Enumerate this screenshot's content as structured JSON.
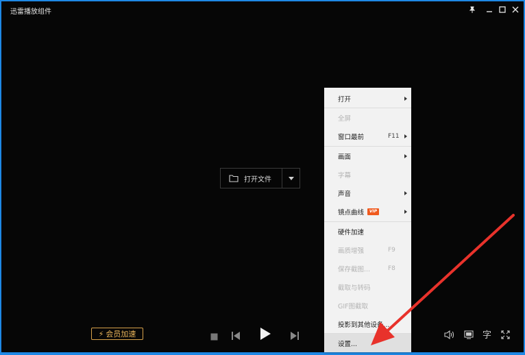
{
  "window": {
    "title": "迅雷播放组件"
  },
  "center": {
    "open_file_label": "打开文件"
  },
  "bottom": {
    "vip_label": "会员加速",
    "subtitle_label": "字"
  },
  "menu": {
    "items": [
      {
        "label": "打开",
        "shortcut": "",
        "submenu": true,
        "disabled": false
      },
      {
        "label": "全屏",
        "shortcut": "",
        "submenu": false,
        "disabled": true
      },
      {
        "label": "窗口最前",
        "shortcut": "F11",
        "submenu": true,
        "disabled": false
      },
      {
        "label": "画面",
        "shortcut": "",
        "submenu": true,
        "disabled": false
      },
      {
        "label": "字幕",
        "shortcut": "",
        "submenu": false,
        "disabled": true
      },
      {
        "label": "声音",
        "shortcut": "",
        "submenu": true,
        "disabled": false
      },
      {
        "label": "镜点曲线",
        "shortcut": "",
        "submenu": true,
        "disabled": false,
        "badge": "VIP"
      },
      {
        "label": "硬件加速",
        "shortcut": "",
        "submenu": false,
        "disabled": false
      },
      {
        "label": "画质增强",
        "shortcut": "F9",
        "submenu": false,
        "disabled": true
      },
      {
        "label": "保存截图...",
        "shortcut": "F8",
        "submenu": false,
        "disabled": true
      },
      {
        "label": "截取与转码",
        "shortcut": "",
        "submenu": false,
        "disabled": true
      },
      {
        "label": "GIF图截取",
        "shortcut": "",
        "submenu": false,
        "disabled": true
      },
      {
        "label": "投影到其他设备...",
        "shortcut": "",
        "submenu": false,
        "disabled": false
      },
      {
        "label": "设置...",
        "shortcut": "",
        "submenu": false,
        "disabled": false,
        "highlighted": true
      }
    ]
  },
  "colors": {
    "accent_blue": "#1e88e5",
    "vip_gold": "#e9b45a",
    "annotation_red": "#e8322b"
  }
}
